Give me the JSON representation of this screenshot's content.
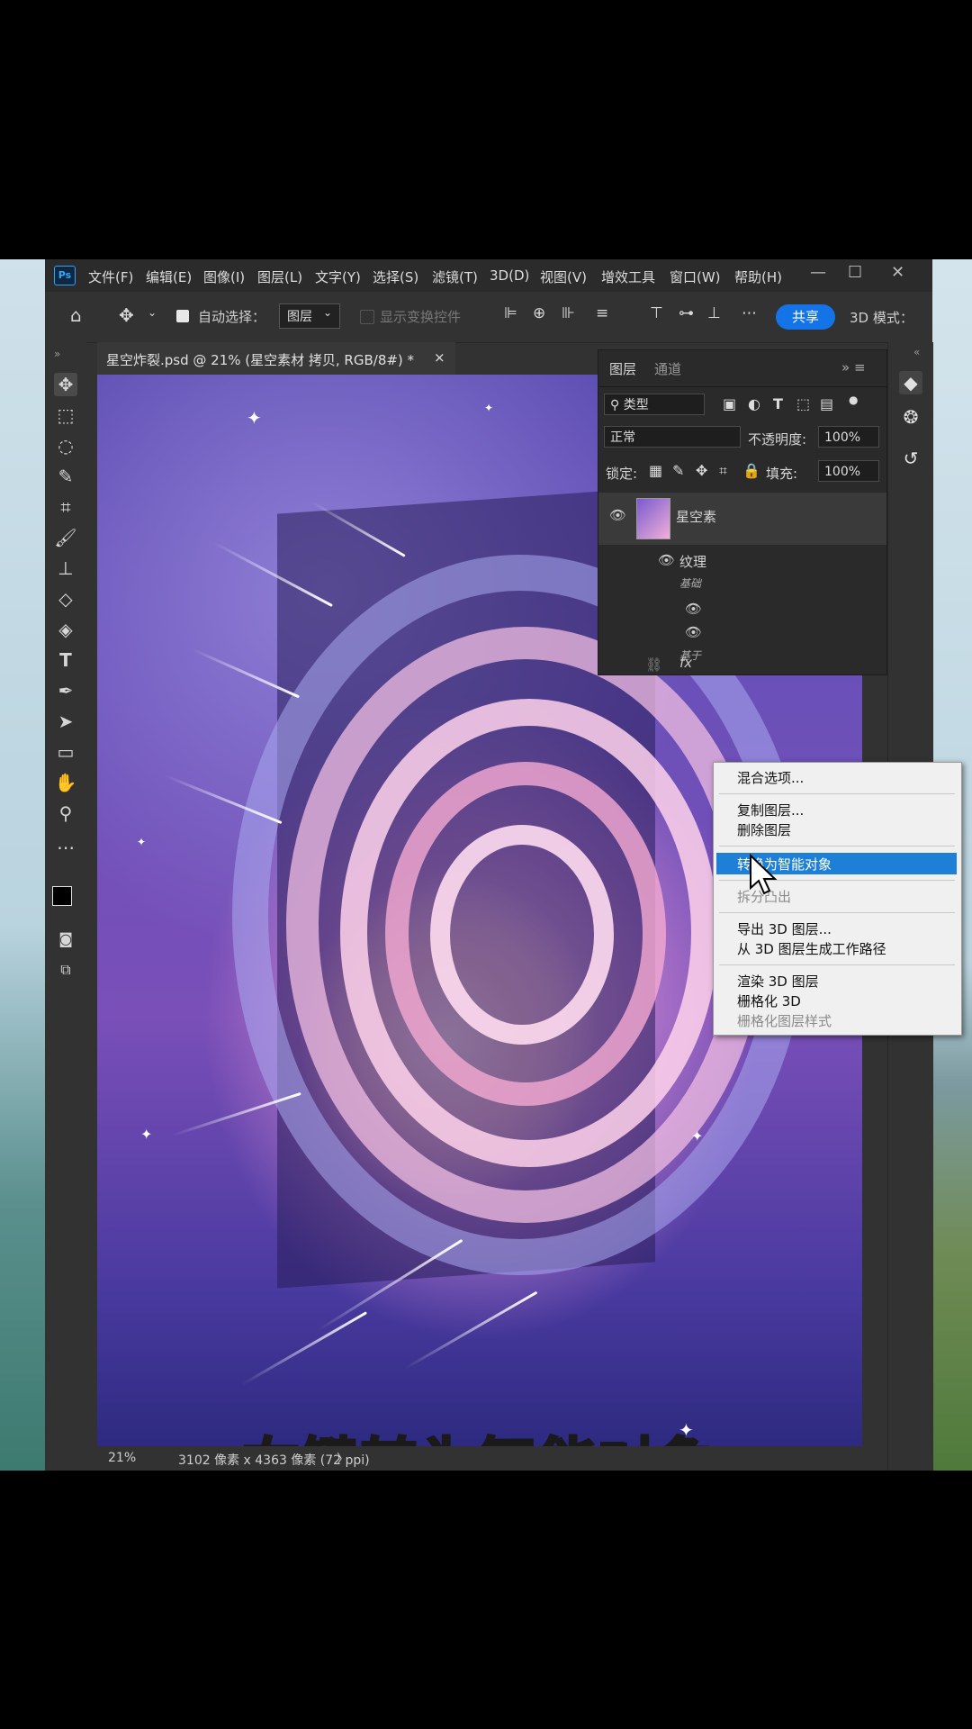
{
  "menubar": {
    "logo": "Ps",
    "items": [
      "文件(F)",
      "编辑(E)",
      "图像(I)",
      "图层(L)",
      "文字(Y)",
      "选择(S)",
      "滤镜(T)",
      "3D(D)",
      "视图(V)",
      "增效工具",
      "窗口(W)",
      "帮助(H)"
    ]
  },
  "options": {
    "auto_select_label": "自动选择：",
    "auto_select_value": "图层",
    "show_transform": "显示变换控件",
    "share": "共享",
    "mode_3d": "3D 模式："
  },
  "document": {
    "tab_title": "星空炸裂.psd @ 21% (星空素材 拷贝, RGB/8#) *",
    "close_glyph": "×",
    "caption": "右键转为智能对象"
  },
  "status": {
    "zoom": "21%",
    "info": "3102 像素 x 4363 像素 (72 ppi)",
    "arrow": "〉"
  },
  "layers_panel": {
    "tabs": [
      "图层",
      "通道"
    ],
    "filter_kind": "类型",
    "blend_mode": "正常",
    "opacity_label": "不透明度:",
    "opacity_value": "100%",
    "lock_label": "锁定:",
    "fill_label": "填充:",
    "fill_value": "100%",
    "layer_name": "星空素",
    "sublayer_name": "纹理",
    "sublayer_note": "基础",
    "sublayer_note2": "基于",
    "fx_label": "fx"
  },
  "context_menu": {
    "items": [
      {
        "label": "混合选项...",
        "enabled": true
      },
      {
        "label": "复制图层...",
        "enabled": true
      },
      {
        "label": "删除图层",
        "enabled": true
      },
      {
        "label": "转换为智能对象",
        "enabled": true,
        "highlighted": true
      },
      {
        "label": "拆分凸出",
        "enabled": false
      },
      {
        "label": "导出 3D 图层...",
        "enabled": true
      },
      {
        "label": "从 3D 图层生成工作路径",
        "enabled": true
      },
      {
        "label": "渲染 3D 图层",
        "enabled": true
      },
      {
        "label": "栅格化 3D",
        "enabled": true
      },
      {
        "label": "栅格化图层样式",
        "enabled": true
      }
    ]
  },
  "colors": {
    "accent": "#1473e6",
    "menu_highlight": "#1e7fd6",
    "caption": "#ffe21a"
  }
}
